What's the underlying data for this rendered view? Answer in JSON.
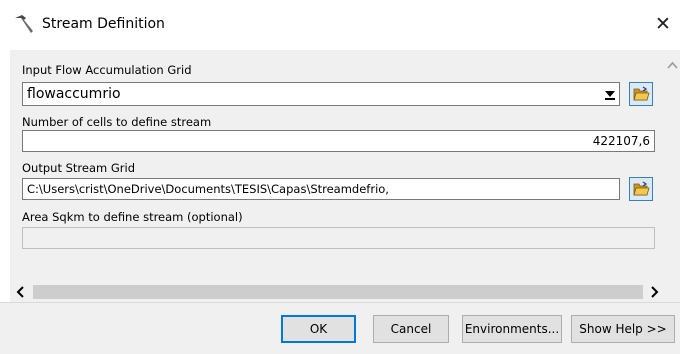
{
  "window": {
    "title": "Stream Definition",
    "title_icon": "hammer-icon",
    "close_glyph": "✕"
  },
  "form": {
    "input_flow": {
      "label": "Input Flow Accumulation Grid",
      "value": "flowaccumrio"
    },
    "num_cells": {
      "label": "Number of cells to define stream",
      "value": "422107,6"
    },
    "output_stream": {
      "label": "Output Stream Grid",
      "value": "C:\\Users\\crist\\OneDrive\\Documents\\TESIS\\Capas\\Streamdefrio,"
    },
    "area_sqkm": {
      "label": "Area Sqkm to define stream (optional)",
      "value": ""
    }
  },
  "buttons": {
    "ok": "OK",
    "cancel": "Cancel",
    "environments": "Environments...",
    "show_help": "Show Help >>"
  },
  "colors": {
    "accent": "#0078d7",
    "folder": "#e8b937",
    "panel": "#f0f0f0"
  }
}
